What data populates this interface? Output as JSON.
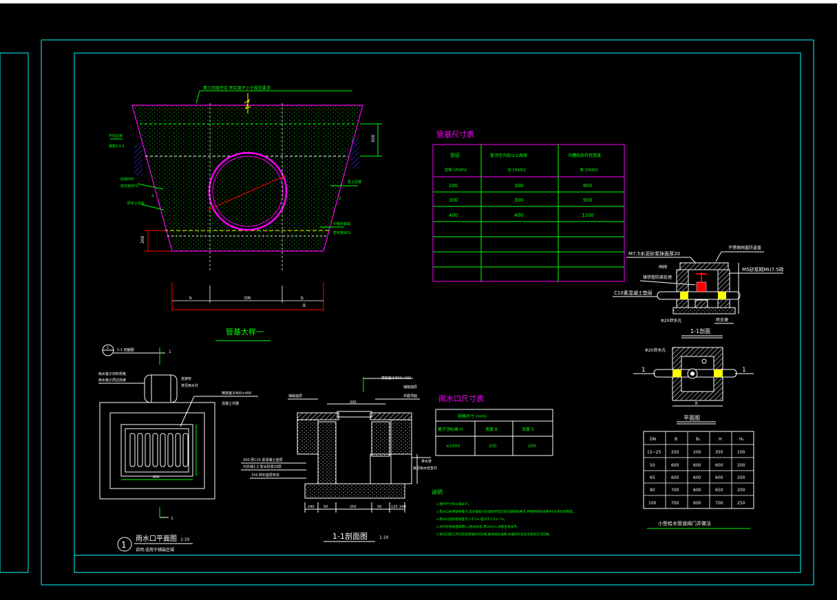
{
  "colors": {
    "background": "#000000",
    "frame": "#00ffff",
    "magenta": "#ff00ff",
    "green": "#00ff00",
    "white": "#ffffff",
    "red": "#ff0000",
    "yellow": "#ffff00",
    "blue": "#3a3aff"
  },
  "pipe_detail": {
    "title": "管基大样一",
    "top_note": "素土回填夯实 密实度不小于规范要求",
    "dim_right": "500",
    "dim_left": "200",
    "dim_b_left": "b",
    "dim_dn": "DN",
    "dim_b_right": "b",
    "dim_total": "B",
    "label_left_1": "开挖边坡",
    "label_left_1b": "坡度1:0.5",
    "label_left_2": "回填中砂",
    "label_left_2b": "密实度95%",
    "label_left_3": "原状土夯实",
    "label_right_1": "素土回填",
    "label_right_2": "中粗砂基础",
    "label_right_2b": "密实度90%",
    "mark_a": "a",
    "mark_b": "2"
  },
  "pipe_table": {
    "title": "管基尺寸表",
    "headers": [
      "管径",
      "管顶至沟底以上高度",
      "沟槽底部开挖宽度"
    ],
    "subheaders": [
      "DN (mm)",
      "b (mm)",
      "B (mm)"
    ],
    "rows": [
      [
        "200",
        "300",
        "800"
      ],
      [
        "300",
        "300",
        "900"
      ],
      [
        "400",
        "400",
        "1200"
      ],
      [
        "",
        "",
        ""
      ],
      [
        "",
        "",
        ""
      ],
      [
        "",
        "",
        ""
      ],
      [
        "",
        "",
        ""
      ]
    ]
  },
  "valve_section": {
    "title": "1-1剖面",
    "label_mortar": "M7.5水泥砂浆抹面厚20",
    "label_cover": "不锈钢阀盖防盗盖",
    "label_valve": "闸阀",
    "label_base": "铸铁管防腐处理",
    "label_brick": "M5砂浆砌MU7.5砖",
    "label_concrete": "C10素混凝土垫层",
    "label_drain": "Φ20泄水孔",
    "label_support": "砖支墩"
  },
  "valve_plan": {
    "title": "平面图",
    "label_drain": "Φ20泄水孔",
    "mark_left": "1",
    "mark_right": "1",
    "dim_b": "B"
  },
  "valve_table": {
    "headers": [
      "DN",
      "B",
      "B₁",
      "H",
      "H₁"
    ],
    "rows": [
      [
        "15~25",
        "250",
        "200",
        "350",
        "100"
      ],
      [
        "50",
        "600",
        "600",
        "600",
        "200"
      ],
      [
        "65",
        "600",
        "600",
        "600",
        "200"
      ],
      [
        "80",
        "700",
        "600",
        "650",
        "200"
      ],
      [
        "100",
        "700",
        "600",
        "700",
        "250"
      ]
    ],
    "caption": "小型给水管道阀门井做法"
  },
  "gully_plan": {
    "number": "1",
    "title": "雨水口平面图",
    "scale": "1:10",
    "note": "说明:适用于铺装区域",
    "legend_no": "1",
    "legend_text": "1-1 剖面图",
    "label_1": "雨水篦子材料规格",
    "label_2": "雨水篦子周边找坡",
    "label_3": "连接管",
    "label_4": "排至雨水井",
    "label_5": "铸铁篦子800×400",
    "label_6": "混凝土井圈",
    "dim_w": "400",
    "mark_1": "1",
    "mark_2": "1"
  },
  "gully_section": {
    "title": "1-1剖面图",
    "scale": "1:10",
    "label_top": "铸铁篦子800×400",
    "label_pave": "铺装面层",
    "label_left": "铺装面层",
    "label_right": "井圈顶面",
    "label_mid": "200",
    "label_l1": "200 厚C15 素混凝土垫层",
    "label_l2": "内外抹1:2 防水砂浆20厚",
    "label_l3": "150 碎石垫层夯实",
    "label_pipe": "排水管",
    "label_pipe2": "接至雨水检查井",
    "dims": [
      "240",
      "50",
      "250",
      "50",
      "120",
      "240"
    ]
  },
  "gully_table": {
    "title": "雨水口尺寸表",
    "header": "规格尺寸 (mm)",
    "col_headers": [
      "篦子顶标高 H",
      "宽度 B",
      "深度 S"
    ],
    "row": [
      "≤1000",
      "200",
      "200"
    ]
  },
  "notes": {
    "title": "说明",
    "lines": [
      "1.图中尺寸均以毫米计。",
      "2.雨水口采用铸铁篦子,其承载能力应满足所在区域车辆荷载要求,井壁砖砌体采用M5水泥砂浆砌筑。",
      "3.雨水口连接管坡度不小于1%,埋深不小于0.7m。",
      "4.井内外壁抹面采用1:2防水砂浆,厚20mm,井底坐浆找平。",
      "5.雨水口施工完毕后须清理井内杂物,确保排水通畅,并做闭水试验合格后方可回填。"
    ]
  }
}
